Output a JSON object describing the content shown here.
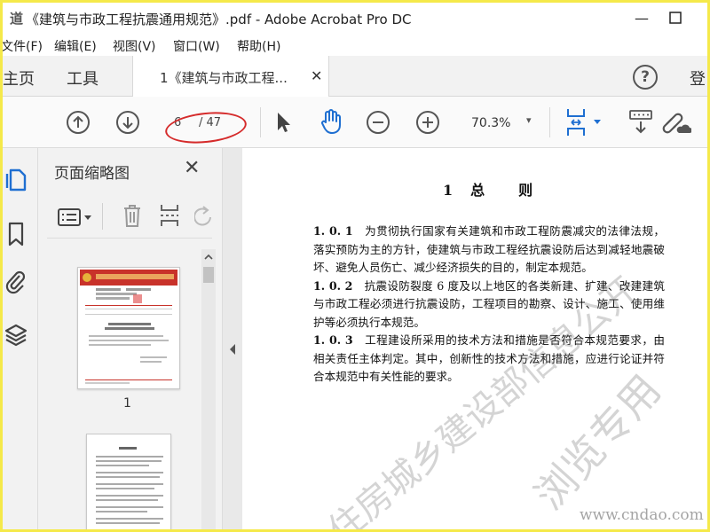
{
  "window": {
    "title": "《建筑与市政工程抗震通用规范》.pdf - Adobe Acrobat Pro DC",
    "app_icon_glyph": "道",
    "minimize": "—",
    "maximize": "☐"
  },
  "menu": {
    "items": [
      "文件(F)",
      "编辑(E)",
      "视图(V)",
      "窗口(W)",
      "帮助(H)"
    ]
  },
  "tabs": {
    "home": "主页",
    "tools": "工具",
    "document": "1《建筑与市政工程...",
    "close": "✕",
    "help": "?",
    "login": "登"
  },
  "toolbar": {
    "current_page": "6",
    "total_pages": "/ 47",
    "zoom": "70.3%",
    "zoom_caret": "▾"
  },
  "thumbnails": {
    "title": "页面缩略图",
    "close": "✕",
    "page1_label": "1"
  },
  "document": {
    "heading": "1　总　　则",
    "clauses": [
      {
        "no": "1. 0. 1",
        "text": "为贯彻执行国家有关建筑和市政工程防震减灾的法律法规，落实预防为主的方针，使建筑与市政工程经抗震设防后达到减轻地震破坏、避免人员伤亡、减少经济损失的目的，制定本规范。"
      },
      {
        "no": "1. 0. 2",
        "text": "抗震设防裂度 6 度及以上地区的各类新建、扩建、改建建筑与市政工程必须进行抗震设防，工程项目的勘察、设计、施工、使用维护等必须执行本规范。"
      },
      {
        "no": "1. 0. 3",
        "text": "工程建设所采用的技术方法和措施是否符合本规范要求，由相关责任主体判定。其中，创新性的技术方法和措施，应进行论证并符合本规范中有关性能的要求。"
      }
    ],
    "watermark_1": "住房城乡建设部信息公开",
    "watermark_2": "浏览专用",
    "site_watermark": "www.cndao.com"
  },
  "colors": {
    "annotation_red": "#d52b2b",
    "accent_blue": "#1f6fd1"
  }
}
